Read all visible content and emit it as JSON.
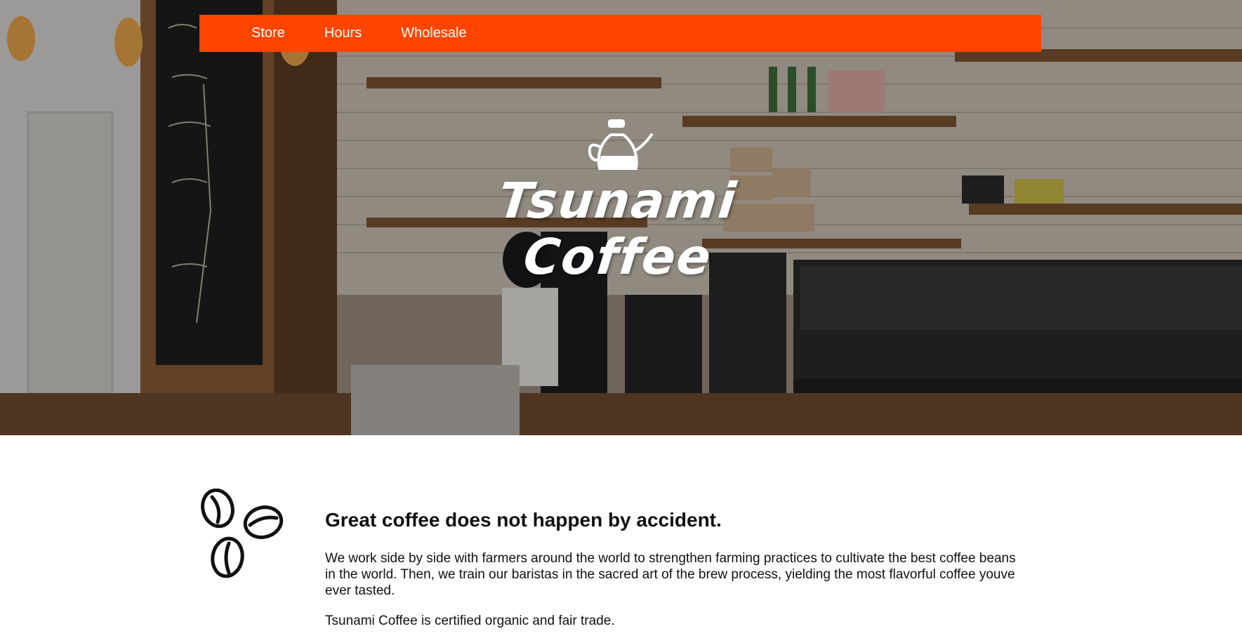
{
  "nav": {
    "items": [
      {
        "label": "Store"
      },
      {
        "label": "Hours"
      },
      {
        "label": "Wholesale"
      }
    ],
    "background_color": "#ff4500"
  },
  "hero": {
    "logo_line1": "Tsunami",
    "logo_line2": "Coffee",
    "logo_icon": "kettle-icon",
    "background_image": "coffee-shop-interior-photo"
  },
  "main": {
    "icon": "coffee-beans-icon",
    "headline": "Great coffee does not happen by accident.",
    "paragraph1": "We work side by side with farmers around the world to strengthen farming practices to cultivate the best coffee beans in the world. Then, we train our baristas in the sacred art of the brew process, yielding the most flavorful coffee youve ever tasted.",
    "paragraph2": "Tsunami Coffee is certified organic and fair trade."
  }
}
